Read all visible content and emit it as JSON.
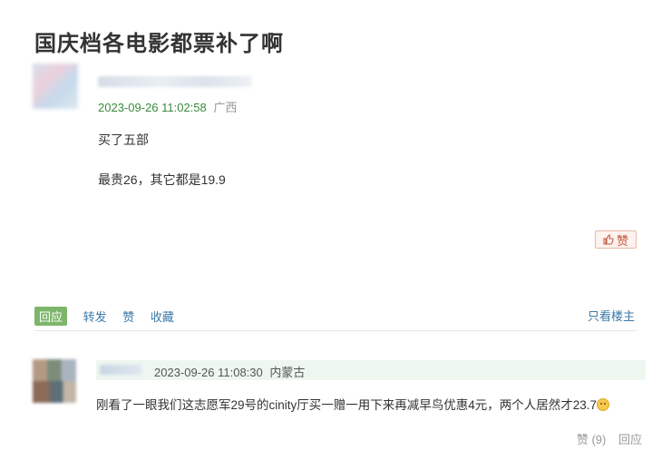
{
  "post": {
    "title": "国庆档各电影都票补了啊",
    "time": "2023-09-26 11:02:58",
    "location": "广西",
    "body_lines": [
      "买了五部",
      "最贵26，其它都是19.9"
    ],
    "like_label": "赞"
  },
  "actions": {
    "reply": "回应",
    "forward": "转发",
    "like": "赞",
    "favorite": "收藏",
    "only_op": "只看楼主"
  },
  "comment": {
    "time": "2023-09-26 11:08:30",
    "location": "内蒙古",
    "text": "刚看了一眼我们这志愿军29号的cinity厅买一赠一用下来再减早鸟优惠4元，两个人居然才23.7",
    "like_count": "赞 (9)",
    "reply": "回应"
  },
  "colors": {
    "time_green": "#3a8a3a",
    "link_blue": "#3c7aa8",
    "reply_tag": "#7db66b"
  }
}
